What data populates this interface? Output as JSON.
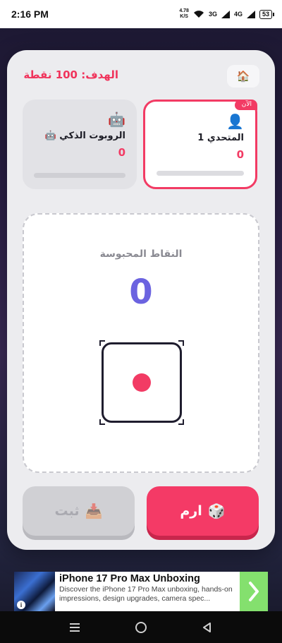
{
  "status_bar": {
    "time": "2:16 PM",
    "net_speed_value": "4.78",
    "net_speed_unit": "K/S",
    "signal1": "3G",
    "signal2": "4G",
    "battery": "53"
  },
  "game": {
    "goal_text": "الهدف: 100 نقطة",
    "home_icon": "🏠",
    "players": [
      {
        "avatar": "👤",
        "name": "المتحدي 1",
        "score": "0",
        "badge": "الآن",
        "active": true
      },
      {
        "avatar": "🤖",
        "name": "الروبوت الذكي 🤖",
        "score": "0",
        "active": false
      }
    ],
    "held_label": "النقاط المحبوسة",
    "held_value": "0",
    "die_face": 1,
    "roll_button": {
      "icon": "🎲",
      "label": "ارم"
    },
    "hold_button": {
      "icon": "📥",
      "label": "ثبت"
    }
  },
  "ad": {
    "title": "iPhone 17 Pro Max Unboxing",
    "description": "Discover the iPhone 17 Pro Max unboxing, hands-on impressions, design upgrades, camera spec...",
    "info_icon": "i"
  },
  "colors": {
    "accent": "#f23b64",
    "held_value": "#6b63e0",
    "ad_cta": "#84e06e"
  }
}
